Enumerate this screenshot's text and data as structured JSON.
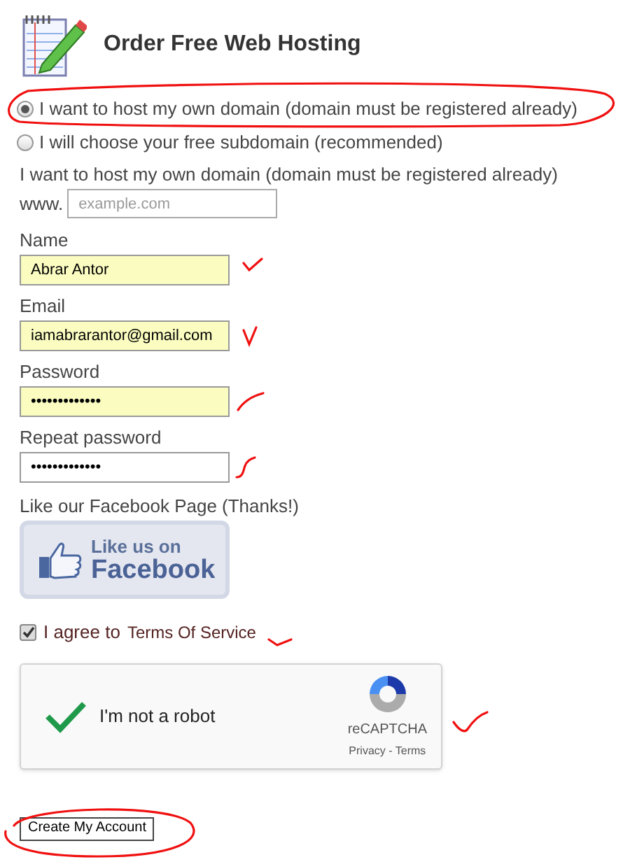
{
  "header": {
    "title": "Order Free Web Hosting"
  },
  "domain_options": [
    {
      "label": "I want to host my own domain (domain must be registered already)",
      "selected": true
    },
    {
      "label": "I will choose your free subdomain (recommended)",
      "selected": false
    }
  ],
  "domain_section": {
    "heading": "I want to host my own domain (domain must be registered already)",
    "prefix": "www.",
    "placeholder": "example.com"
  },
  "fields": [
    {
      "label": "Name",
      "value": "Abrar Antor",
      "autofilled": true
    },
    {
      "label": "Email",
      "value": "iamabrarantor@gmail.com",
      "autofilled": true
    },
    {
      "label": "Password",
      "value": "•••••••••••••",
      "autofilled": true
    },
    {
      "label": "Repeat password",
      "value": "•••••••••••••",
      "autofilled": false
    }
  ],
  "facebook": {
    "label": "Like our Facebook Page (Thanks!)",
    "button_line_1": "Like us on",
    "button_line_2": "Facebook"
  },
  "terms": {
    "checked": true,
    "text": "I agree to",
    "link": "Terms Of Service"
  },
  "captcha": {
    "checked": true,
    "label": "I'm not a robot",
    "brand": "reCAPTCHA",
    "links": "Privacy - Terms"
  },
  "submit": {
    "label": "Create My Account"
  }
}
